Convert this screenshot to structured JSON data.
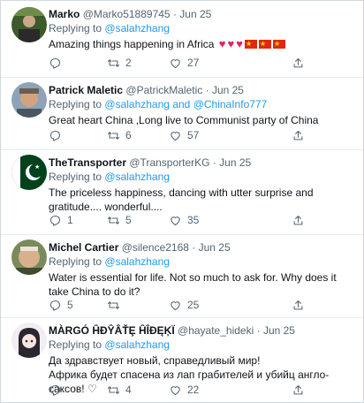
{
  "tweets": [
    {
      "name": "Marko",
      "handle": "@Marko51889745",
      "date": "Jun 25",
      "reply_prefix": "Replying to",
      "reply_to": "@salahzhang",
      "reply_and": "",
      "reply_to2": "",
      "text": "Amazing things happening in Africa",
      "replies": "",
      "retweets": "2",
      "likes": "27"
    },
    {
      "name": "Patrick Maletic",
      "handle": "@PatrickMaletic",
      "date": "Jun 25",
      "reply_prefix": "Replying to",
      "reply_to": "@salahzhang",
      "reply_and": "and",
      "reply_to2": "@ChinaInfo777",
      "text": "Great heart China ,Long live to Communist party of China",
      "replies": "",
      "retweets": "6",
      "likes": "57"
    },
    {
      "name": "TheTransporter",
      "handle": "@TransporterKG",
      "date": "Jun 25",
      "reply_prefix": "Replying to",
      "reply_to": "@salahzhang",
      "reply_and": "",
      "reply_to2": "",
      "text": "The priceless happiness, dancing with utter surprise and gratitude.... wonderful....",
      "replies": "1",
      "retweets": "5",
      "likes": "35"
    },
    {
      "name": "Michel Cartier",
      "handle": "@silence2168",
      "date": "Jun 25",
      "reply_prefix": "Replying to",
      "reply_to": "@salahzhang",
      "reply_and": "",
      "reply_to2": "",
      "text": "Water is essential for life. Not so much to ask for. Why does it take China to do it?",
      "replies": "5",
      "retweets": "",
      "likes": "25"
    },
    {
      "name": "MÀRGÓ ĤĐŶÂŤȨ ĤÎĐĘĶÏ",
      "handle": "@hayate_hideki",
      "date": "Jun 25",
      "reply_prefix": "Replying to",
      "reply_to": "@salahzhang",
      "reply_and": "",
      "reply_to2": "",
      "text": "Да здравствует новый, справедливый мир!\nАфрика будет спасена из лап грабителей и убийц англо-саксов! ♡",
      "replies": "",
      "retweets": "4",
      "likes": "22"
    }
  ],
  "colors": {
    "accent": "#1d9bf0",
    "muted": "#536471",
    "heart": "#e0245e",
    "flag": "#de2910"
  },
  "icons": [
    "reply-icon",
    "retweet-icon",
    "like-icon",
    "share-icon"
  ]
}
